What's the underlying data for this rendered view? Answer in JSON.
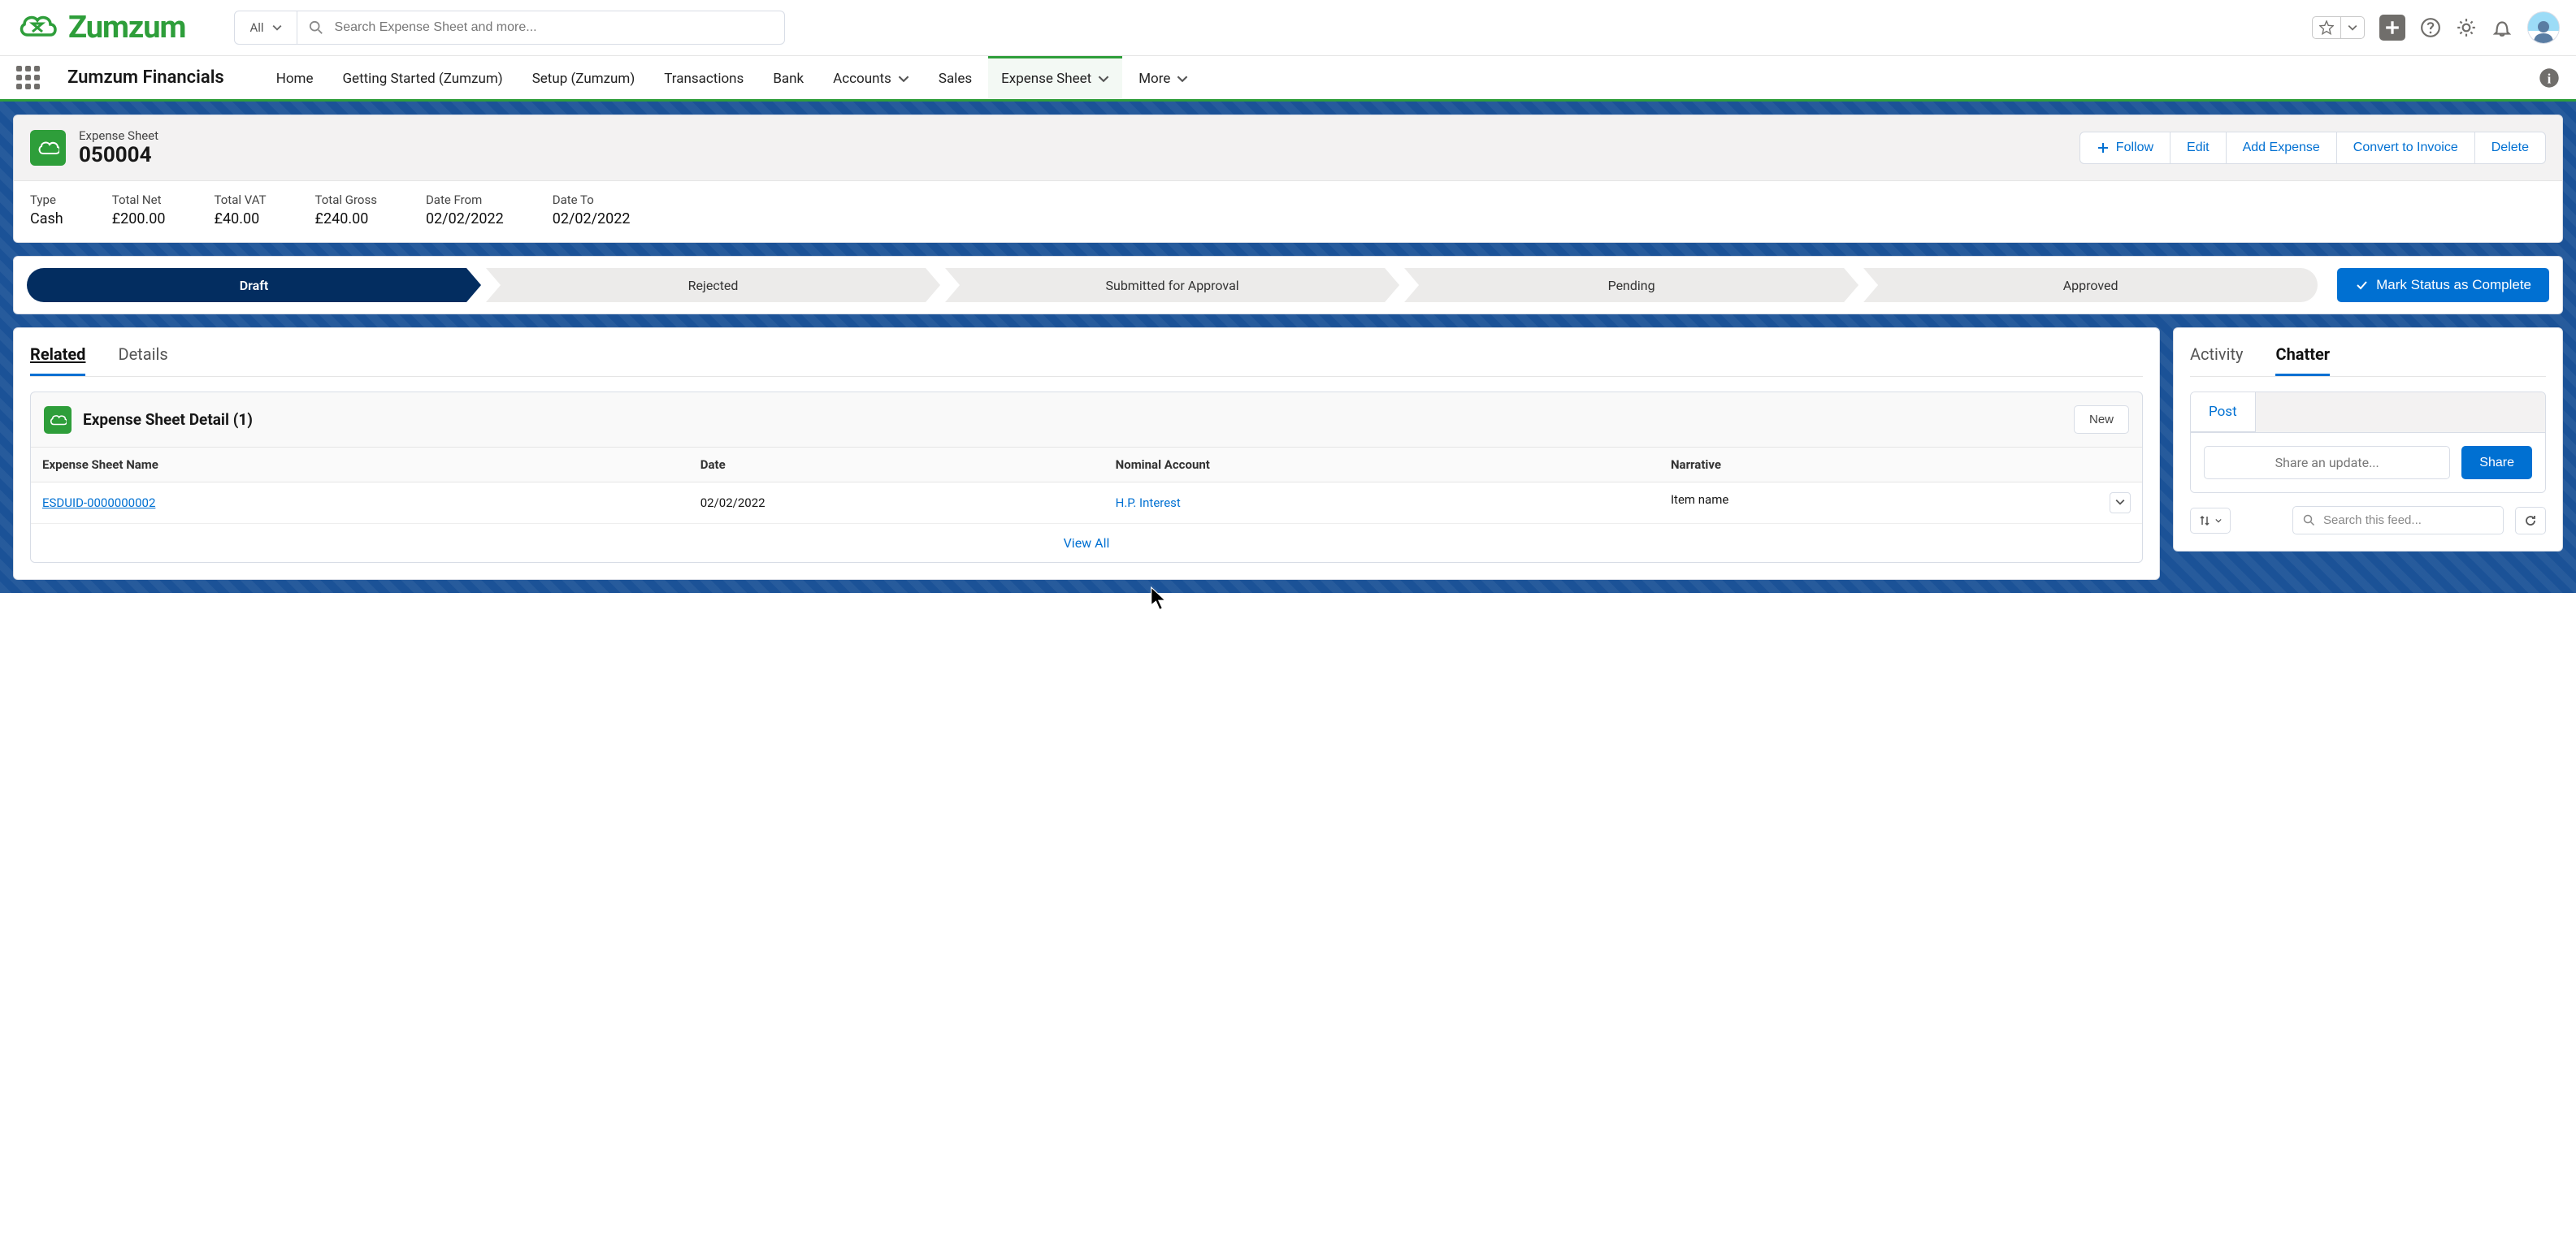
{
  "header": {
    "search_scope": "All",
    "search_placeholder": "Search Expense Sheet and more..."
  },
  "nav": {
    "app_name": "Zumzum Financials",
    "items": [
      {
        "label": "Home"
      },
      {
        "label": "Getting Started (Zumzum)"
      },
      {
        "label": "Setup (Zumzum)"
      },
      {
        "label": "Transactions"
      },
      {
        "label": "Bank"
      },
      {
        "label": "Accounts",
        "dropdown": true
      },
      {
        "label": "Sales"
      },
      {
        "label": "Expense Sheet",
        "dropdown": true,
        "active": true
      },
      {
        "label": "More",
        "dropdown": true
      }
    ]
  },
  "record": {
    "object_label": "Expense Sheet",
    "name": "050004",
    "actions": {
      "follow": "Follow",
      "edit": "Edit",
      "add_expense": "Add Expense",
      "convert": "Convert to Invoice",
      "delete": "Delete"
    },
    "fields": [
      {
        "label": "Type",
        "value": "Cash"
      },
      {
        "label": "Total Net",
        "value": "£200.00"
      },
      {
        "label": "Total VAT",
        "value": "£40.00"
      },
      {
        "label": "Total Gross",
        "value": "£240.00"
      },
      {
        "label": "Date From",
        "value": "02/02/2022"
      },
      {
        "label": "Date To",
        "value": "02/02/2022"
      }
    ]
  },
  "path": {
    "steps": [
      "Draft",
      "Rejected",
      "Submitted for Approval",
      "Pending",
      "Approved"
    ],
    "current": "Draft",
    "complete_label": "Mark Status as Complete"
  },
  "left": {
    "tabs": {
      "related": "Related",
      "details": "Details"
    },
    "related": {
      "title": "Expense Sheet Detail (1)",
      "new_label": "New",
      "columns": [
        "Expense Sheet Name",
        "Date",
        "Nominal Account",
        "Narrative"
      ],
      "rows": [
        {
          "name": "ESDUID-0000000002",
          "date": "02/02/2022",
          "nominal": "H.P. Interest",
          "narrative": "Item name"
        }
      ],
      "view_all": "View All"
    }
  },
  "right": {
    "tabs": {
      "activity": "Activity",
      "chatter": "Chatter"
    },
    "post_tab": "Post",
    "composer_placeholder": "Share an update...",
    "share_label": "Share",
    "feed_search_placeholder": "Search this feed..."
  },
  "logo_text": "Zumzum"
}
